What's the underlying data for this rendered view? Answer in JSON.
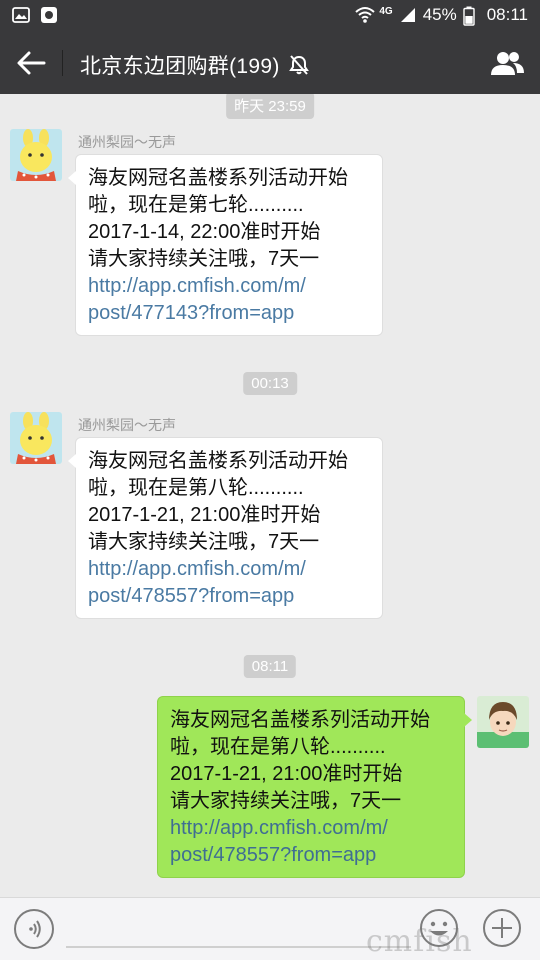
{
  "status_bar": {
    "network": "4G",
    "battery": "45%",
    "time": "08:11",
    "icons": [
      "photo-icon",
      "app-icon",
      "wifi-icon",
      "signal-icon",
      "battery-icon"
    ]
  },
  "header": {
    "title": "北京东边团购群(199)",
    "icons": [
      "back-arrow-icon",
      "mute-icon",
      "group-members-icon"
    ]
  },
  "messages": [
    {
      "time_divider": "昨天 23:59",
      "sender": "通州梨园～无声",
      "direction": "incoming",
      "lines": [
        "海友网冠名盖楼系列活动开始",
        "啦，现在是第七轮..........",
        "2017-1-14, 22:00准时开始",
        "请大家持续关注哦，7天一"
      ],
      "link_lines": [
        "http://app.cmfish.com/m/",
        "post/477143?from=app"
      ]
    },
    {
      "time_divider": "00:13",
      "sender": "通州梨园～无声",
      "direction": "incoming",
      "lines": [
        "海友网冠名盖楼系列活动开始",
        "啦，现在是第八轮..........",
        "2017-1-21, 21:00准时开始",
        "请大家持续关注哦，7天一"
      ],
      "link_lines": [
        "http://app.cmfish.com/m/",
        "post/478557?from=app"
      ]
    },
    {
      "time_divider": "08:11",
      "sender": "",
      "direction": "outgoing",
      "lines": [
        "海友网冠名盖楼系列活动开始",
        "啦，现在是第八轮..........",
        "2017-1-21, 21:00准时开始",
        "请大家持续关注哦，7天一"
      ],
      "link_lines": [
        "http://app.cmfish.com/m/",
        "post/478557?from=app"
      ]
    }
  ],
  "input_bar": {
    "icons": [
      "voice-icon",
      "emoji-icon",
      "plus-icon"
    ]
  },
  "watermark": "cmfish",
  "colors": {
    "header_bg": "#39393b",
    "chat_bg": "#ebebeb",
    "incoming_bubble": "#ffffff",
    "outgoing_bubble": "#a0e759",
    "link": "#4a7aa3"
  }
}
